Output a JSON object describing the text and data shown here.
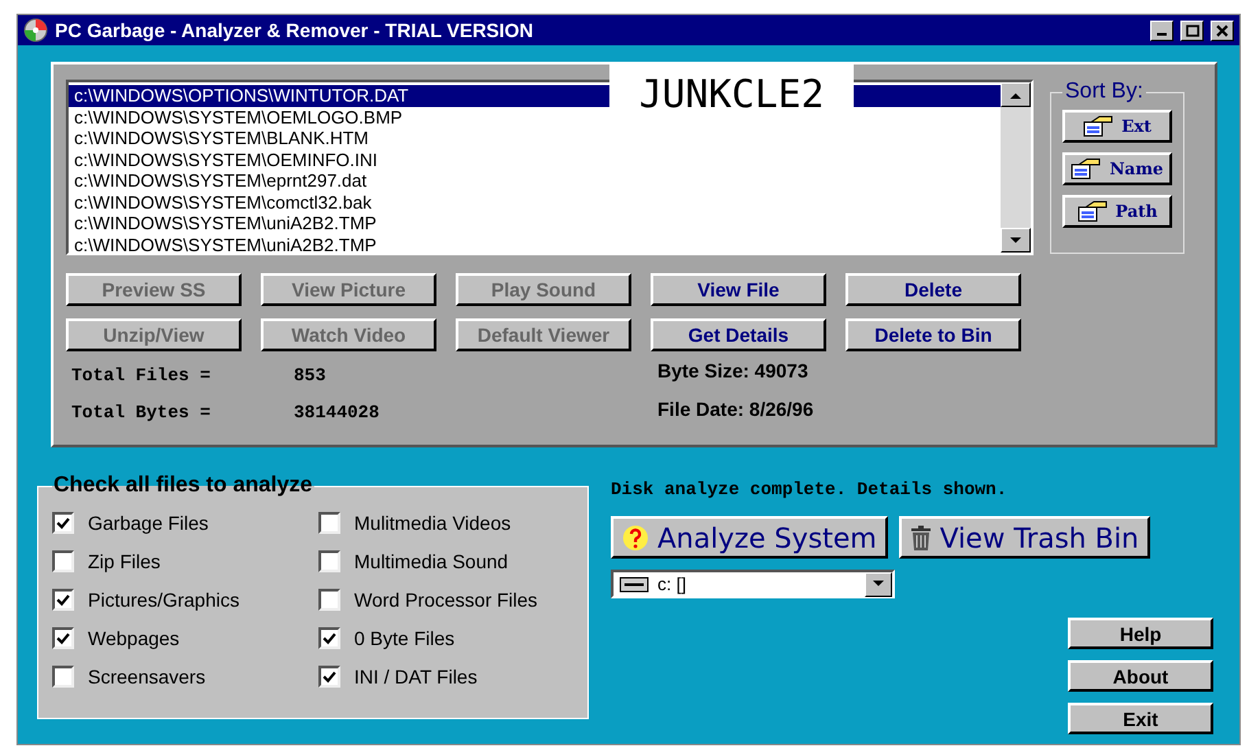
{
  "window": {
    "title": "PC Garbage - Analyzer & Remover - TRIAL VERSION"
  },
  "files": [
    {
      "path": "c:\\WINDOWS\\OPTIONS\\WINTUTOR.DAT",
      "selected": true
    },
    {
      "path": "c:\\WINDOWS\\SYSTEM\\OEMLOGO.BMP",
      "selected": false
    },
    {
      "path": "c:\\WINDOWS\\SYSTEM\\BLANK.HTM",
      "selected": false
    },
    {
      "path": "c:\\WINDOWS\\SYSTEM\\OEMINFO.INI",
      "selected": false
    },
    {
      "path": "c:\\WINDOWS\\SYSTEM\\eprnt297.dat",
      "selected": false
    },
    {
      "path": "c:\\WINDOWS\\SYSTEM\\comctl32.bak",
      "selected": false
    },
    {
      "path": "c:\\WINDOWS\\SYSTEM\\uniA2B2.TMP",
      "selected": false
    },
    {
      "path": "c:\\WINDOWS\\SYSTEM\\uniA2B2.TMP",
      "selected": false
    }
  ],
  "logo": "JUNKCLE2",
  "sort": {
    "title": "Sort By:",
    "buttons": [
      "Ext",
      "Name",
      "Path"
    ]
  },
  "actions": [
    {
      "label": "Preview SS",
      "disabled": true
    },
    {
      "label": "View Picture",
      "disabled": true
    },
    {
      "label": "Play Sound",
      "disabled": true
    },
    {
      "label": "View File",
      "disabled": false
    },
    {
      "label": "Delete",
      "disabled": false
    },
    {
      "label": "Unzip/View",
      "disabled": true
    },
    {
      "label": "Watch Video",
      "disabled": true
    },
    {
      "label": "Default Viewer",
      "disabled": true
    },
    {
      "label": "Get Details",
      "disabled": false
    },
    {
      "label": "Delete to Bin",
      "disabled": false
    }
  ],
  "totals": [
    {
      "label": "Total Files =",
      "value": "853"
    },
    {
      "label": "Total Bytes =",
      "value": "38144028"
    }
  ],
  "details": [
    "Byte Size: 49073",
    "File Date: 8/26/96"
  ],
  "filetypes": {
    "title": "Check all files to analyze",
    "items": [
      {
        "label": "Garbage Files",
        "checked": true
      },
      {
        "label": "Zip Files",
        "checked": false
      },
      {
        "label": "Pictures/Graphics",
        "checked": true
      },
      {
        "label": "Webpages",
        "checked": true
      },
      {
        "label": "Screensavers",
        "checked": false
      },
      {
        "label": "Mulitmedia Videos",
        "checked": false
      },
      {
        "label": "Multimedia Sound",
        "checked": false
      },
      {
        "label": "Word Processor Files",
        "checked": false
      },
      {
        "label": "0 Byte Files",
        "checked": true
      },
      {
        "label": "INI / DAT Files",
        "checked": true
      }
    ]
  },
  "status": "Disk analyze complete. Details shown.",
  "analyze_button": "Analyze System",
  "trash_button": "View Trash Bin",
  "drive": {
    "value": "c: []"
  },
  "side_buttons": [
    "Help",
    "About",
    "Exit"
  ]
}
